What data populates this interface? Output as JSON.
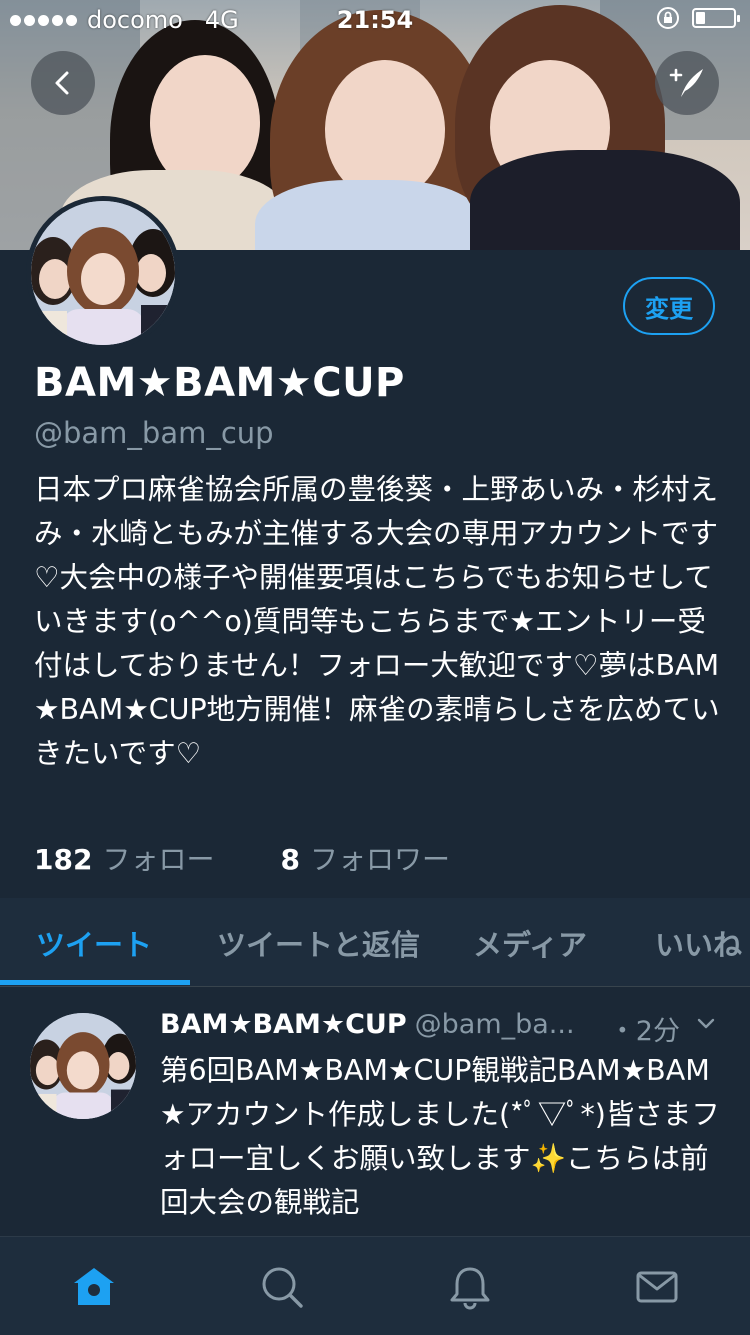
{
  "status_bar": {
    "carrier": "docomo",
    "network": "4G",
    "time": "21:54",
    "battery_level": 0.25
  },
  "header": {
    "back_icon": "chevron-left-icon",
    "compose_icon": "compose-tweet-icon"
  },
  "profile": {
    "display_name": "BAM★BAM★CUP",
    "handle": "@bam_bam_cup",
    "edit_label": "変更",
    "bio": "日本プロ麻雀協会所属の豊後葵・上野あいみ・杉村えみ・水崎ともみが主催する大会の専用アカウントです♡大会中の様子や開催要項はこちらでもお知らせしていきます(o^^o)質問等もこちらまで★エントリー受付はしておりません！フォロー大歓迎です♡夢はBAM★BAM★CUP地方開催！麻雀の素晴らしさを広めていきたいです♡",
    "following_count": "182",
    "following_label": "フォロー",
    "followers_count": "8",
    "followers_label": "フォロワー"
  },
  "tabs": [
    {
      "label": "ツイート",
      "active": true
    },
    {
      "label": "ツイートと返信",
      "active": false
    },
    {
      "label": "メディア",
      "active": false
    },
    {
      "label": "いいね",
      "active": false
    }
  ],
  "tweet": {
    "name": "BAM★BAM★CUP",
    "handle": "@bam_ba...",
    "time": "・2分",
    "text_before_emoji": "第6回BAM★BAM★CUP観戦記BAM★BAM★アカウント作成しました(*ﾟ▽ﾟ*)皆さまフォロー宜しくお願い致します",
    "emoji": "✨",
    "text_after_emoji": "こちらは前回大会の観戦記"
  },
  "bottom_nav": [
    {
      "icon": "home-icon",
      "active": true
    },
    {
      "icon": "search-icon",
      "active": false
    },
    {
      "icon": "notifications-bell-icon",
      "active": false
    },
    {
      "icon": "messages-envelope-icon",
      "active": false
    }
  ],
  "colors": {
    "background": "#1b2836",
    "accent": "#1da1f2",
    "secondary_text": "#8899a6"
  }
}
